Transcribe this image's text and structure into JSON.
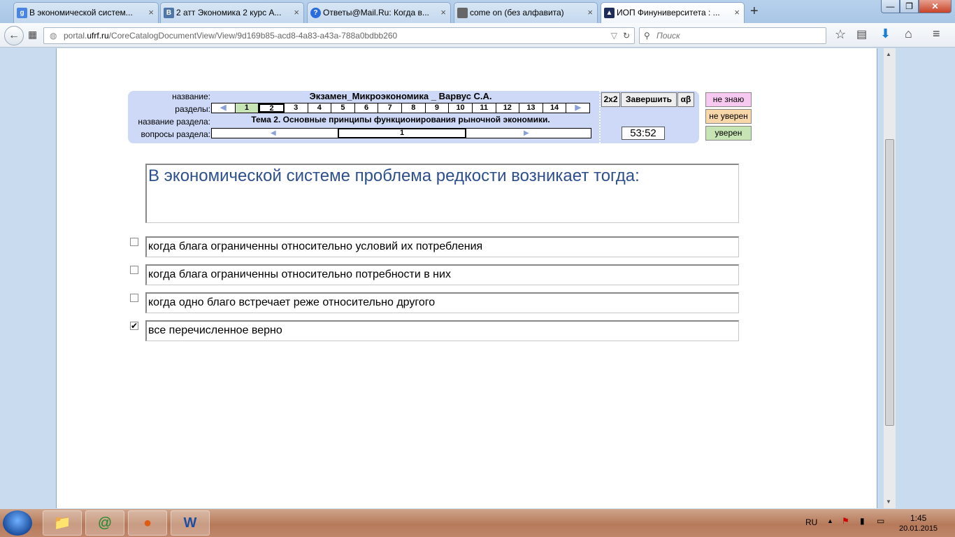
{
  "tabs": [
    {
      "label": "В экономической систем...",
      "icon": "google-icon",
      "color": "#4b85e3",
      "glyph": "g"
    },
    {
      "label": "2 атт Экономика 2 курс А...",
      "icon": "vk-icon",
      "color": "#4f76a8",
      "glyph": "B"
    },
    {
      "label": "Ответы@Mail.Ru: Когда в...",
      "icon": "mail-answers-icon",
      "color": "#2b6be0",
      "glyph": "?"
    },
    {
      "label": "come on (без алфавита)",
      "icon": "image-icon",
      "color": "#666666",
      "glyph": ""
    },
    {
      "label": "ИОП Финуниверситета : ...",
      "icon": "graduation-cap-icon",
      "color": "#1e2d5a",
      "glyph": ""
    }
  ],
  "nav": {
    "url_prefix": "portal.",
    "url_host": "ufrf.ru",
    "url_path": "/CoreCatalogDocumentView/View/9d169b85-acd8-4a83-a43a-788a0bdbb260",
    "search_placeholder": "Поиск"
  },
  "exam": {
    "label_name": "название:",
    "label_sections": "разделы:",
    "label_section_name": "название раздела:",
    "label_questions": "вопросы раздела:",
    "title": "Экзамен_Микроэкономика _ Варвус С.А.",
    "sections": [
      "1",
      "2",
      "3",
      "4",
      "5",
      "6",
      "7",
      "8",
      "9",
      "10",
      "11",
      "12",
      "13",
      "14"
    ],
    "done_section": "1",
    "current_section": "2",
    "section_name": "Тема 2. Основные принципы функционирования рыночной экономики.",
    "current_question": "1",
    "btn_2x2": "2x2",
    "btn_finish": "Завершить",
    "btn_alphabet": "αβ",
    "timer": "53:52"
  },
  "confidence": [
    {
      "label": "не знаю",
      "color": "#f7c8f0"
    },
    {
      "label": "не уверен",
      "color": "#f8d8a8"
    },
    {
      "label": "уверен",
      "color": "#c7e5b4"
    }
  ],
  "question": "В экономической системе проблема редкости возникает тогда:",
  "answers": [
    {
      "text": "когда блага ограниченны относительно условий их потребления",
      "checked": false
    },
    {
      "text": "когда блага ограниченны относительно потребности в них",
      "checked": false
    },
    {
      "text": "когда одно благо встречает реже относительно другого",
      "checked": false
    },
    {
      "text": "все перечисленное верно",
      "checked": true
    }
  ],
  "tray": {
    "lang": "RU",
    "time": "1:45",
    "date": "20.01.2015"
  }
}
